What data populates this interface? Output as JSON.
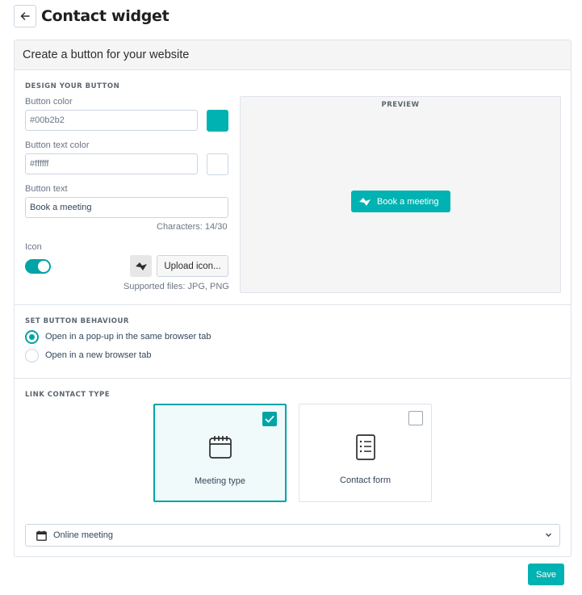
{
  "header": {
    "title": "Contact widget",
    "back_icon": "arrow-left-icon"
  },
  "card": {
    "title": "Create a button for your website"
  },
  "design": {
    "section_title": "DESIGN YOUR BUTTON",
    "button_color_label": "Button color",
    "button_color_value": "#00b2b2",
    "button_text_color_label": "Button text color",
    "button_text_color_value": "#ffffff",
    "button_text_label": "Button text",
    "button_text_value": "Book a meeting",
    "char_count": "Characters: 14/30",
    "icon_label": "Icon",
    "icon_enabled": true,
    "upload_label": "Upload icon...",
    "supported_files": "Supported files: JPG, PNG"
  },
  "preview": {
    "title": "PREVIEW",
    "button_label": "Book a meeting"
  },
  "behaviour": {
    "section_title": "SET BUTTON BEHAVIOUR",
    "options": [
      {
        "label": "Open in a pop-up in the same browser tab",
        "selected": true
      },
      {
        "label": "Open in a new browser tab",
        "selected": false
      }
    ]
  },
  "contact": {
    "section_title": "LINK CONTACT TYPE",
    "tiles": [
      {
        "label": "Meeting type",
        "selected": true,
        "icon": "calendar-icon"
      },
      {
        "label": "Contact form",
        "selected": false,
        "icon": "form-icon"
      }
    ],
    "select_value": "Online meeting"
  },
  "actions": {
    "save_label": "Save"
  },
  "colors": {
    "accent": "#00a4a6",
    "brand_button": "#00b2b2",
    "text": "#33475b",
    "border": "#cbd6e2"
  }
}
